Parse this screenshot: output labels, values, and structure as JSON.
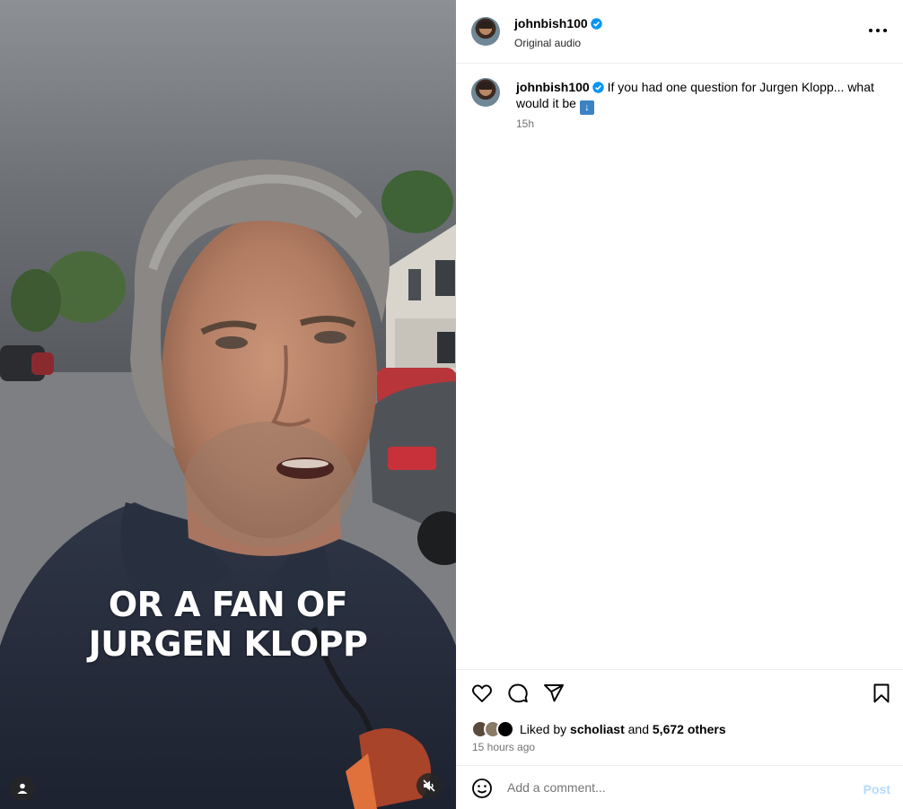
{
  "video": {
    "caption_line1": "OR A FAN OF",
    "caption_line2": "JURGEN KLOPP",
    "user_icon": "person-icon",
    "mute_icon": "speaker-muted-icon"
  },
  "header": {
    "username": "johnbish100",
    "verified_icon": "verified-badge-icon",
    "audio_label": "Original audio",
    "more_icon": "more-options-icon"
  },
  "caption_comment": {
    "username": "johnbish100",
    "text": "If you had one question for Jurgen Klopp... what would it be",
    "emoji": "⬇️",
    "time": "15h"
  },
  "actions": {
    "like_icon": "heart-icon",
    "comment_icon": "comment-icon",
    "share_icon": "share-icon",
    "save_icon": "bookmark-icon",
    "liked_by_prefix": "Liked by",
    "liked_by_user": "scholiast",
    "liked_by_and": "and",
    "liked_by_others": "5,672 others",
    "posted_time": "15 hours ago"
  },
  "composer": {
    "emoji_icon": "smiley-icon",
    "placeholder": "Add a comment...",
    "post_label": "Post"
  },
  "colors": {
    "verified": "#0095f6",
    "post_disabled": "#b3dbff",
    "meta_gray": "#737373"
  }
}
